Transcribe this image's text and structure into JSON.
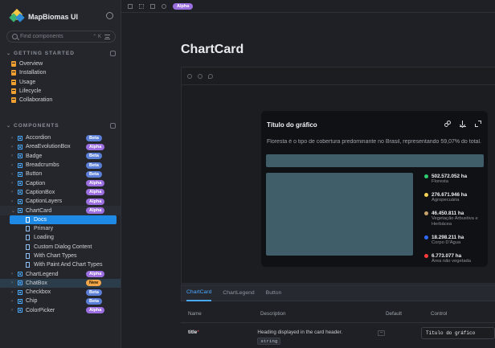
{
  "brand": {
    "title": "MapBiomas UI"
  },
  "search": {
    "placeholder": "Find components",
    "shortcut": "⌃ K"
  },
  "sidebar": {
    "getting_started_label": "GETTING STARTED",
    "getting_started": [
      "Overview",
      "Installation",
      "Usage",
      "Lifecycle",
      "Collaboration"
    ],
    "components_label": "COMPONENTS",
    "components": [
      {
        "label": "Accordion",
        "badge": "Beta"
      },
      {
        "label": "AreaEvolutionBox",
        "badge": "Alpha"
      },
      {
        "label": "Badge",
        "badge": "Beta"
      },
      {
        "label": "Breadcrumbs",
        "badge": "Beta"
      },
      {
        "label": "Button",
        "badge": "Beta"
      },
      {
        "label": "Caption",
        "badge": "Alpha"
      },
      {
        "label": "CaptionBox",
        "badge": "Alpha"
      },
      {
        "label": "CaptionLayers",
        "badge": "Alpha"
      },
      {
        "label": "ChartCard",
        "badge": "Alpha"
      }
    ],
    "chartcard_stories": [
      "Docs",
      "Primary",
      "Loading",
      "Custom Dialog Content",
      "With Chart Types",
      "With Paint And Chart Types"
    ],
    "components_after": [
      {
        "label": "ChartLegend",
        "badge": "Alpha"
      },
      {
        "label": "ChatBox",
        "badge": "New"
      },
      {
        "label": "Checkbox",
        "badge": "Beta"
      },
      {
        "label": "Chip",
        "badge": "Beta"
      },
      {
        "label": "ColorPicker",
        "badge": "Alpha"
      }
    ]
  },
  "toolbar": {
    "badge": "Alpha"
  },
  "page": {
    "title": "ChartCard"
  },
  "card": {
    "title": "Título do gráfico",
    "description": "Floresta é o tipo de cobertura predominante no Brasil, representando 59,07% do total.",
    "legend": [
      {
        "value": "502.572.052 ha",
        "label": "Floresta",
        "color": "#2ecc71"
      },
      {
        "value": "276.671.946 ha",
        "label": "Agropecuária",
        "color": "#f6d155"
      },
      {
        "value": "46.450.811 ha",
        "label": "Vegetação Arbustiva e Herbácea",
        "color": "#c7a36b"
      },
      {
        "value": "18.298.211 ha",
        "label": "Corpo D'Água",
        "color": "#2f6bff"
      },
      {
        "value": "6.773.077 ha",
        "label": "Área não vegetada",
        "color": "#ff3b3b"
      }
    ]
  },
  "tabs": [
    "ChartCard",
    "ChartLegend",
    "Button"
  ],
  "args": {
    "headers": {
      "name": "Name",
      "description": "Description",
      "default": "Default",
      "control": "Control"
    },
    "rows": [
      {
        "name": "title",
        "required": "*",
        "description": "Heading displayed in the card header.",
        "type": "string",
        "default": "–",
        "control": "Título do gráfico"
      }
    ]
  }
}
